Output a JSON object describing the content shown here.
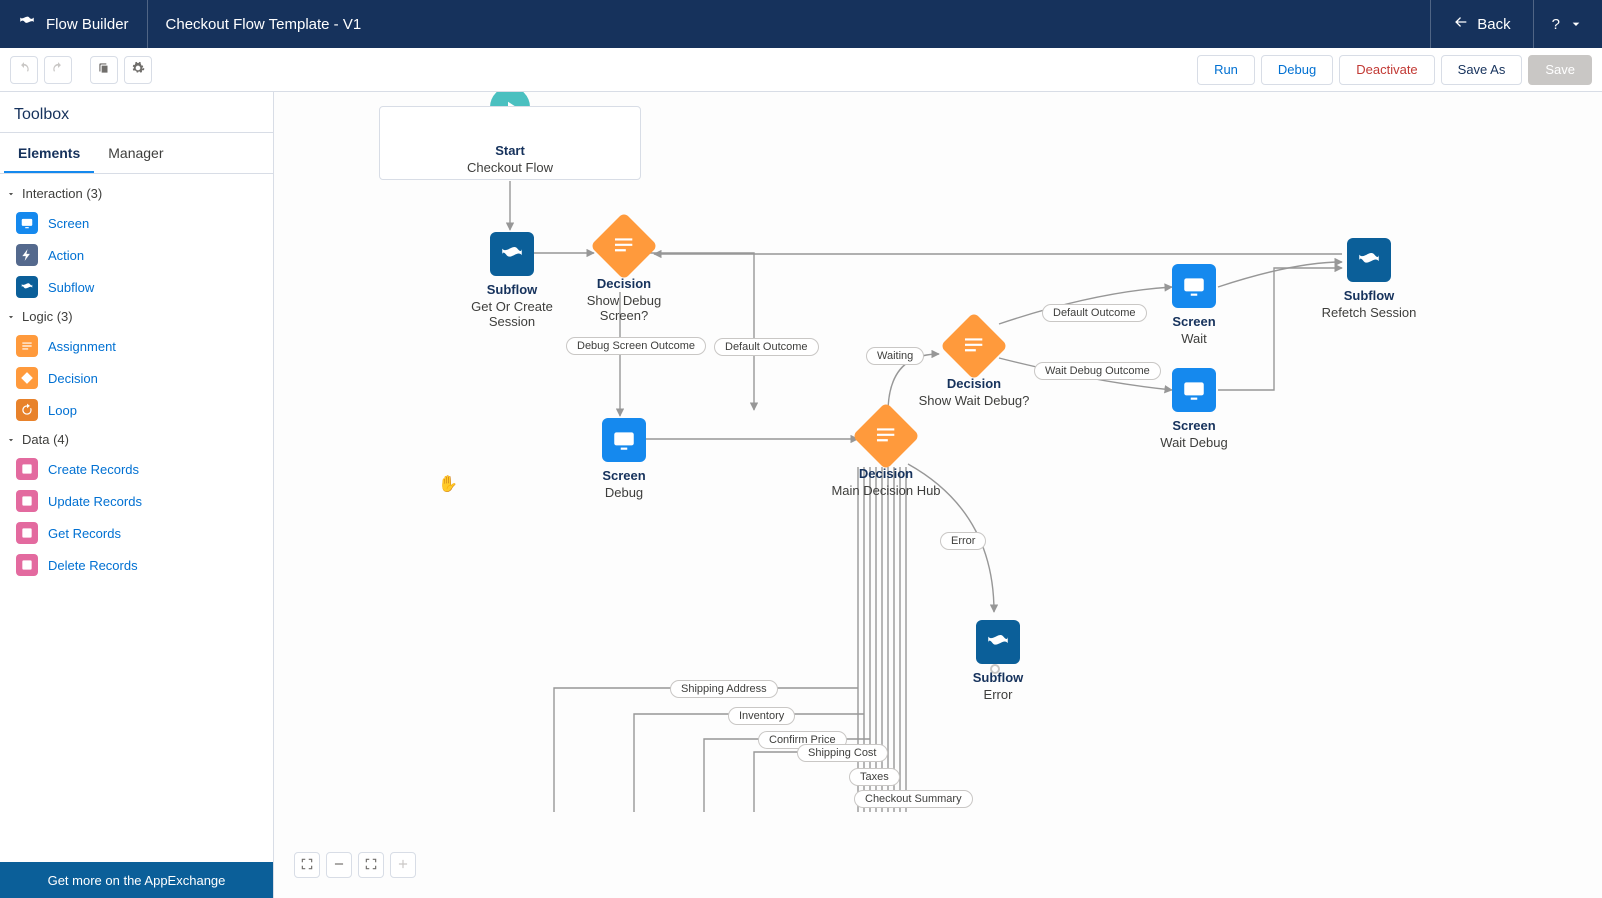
{
  "header": {
    "app_name": "Flow Builder",
    "flow_title": "Checkout Flow Template - V1",
    "back_label": "Back",
    "help_label": "?"
  },
  "actions": {
    "run": "Run",
    "debug": "Debug",
    "deactivate": "Deactivate",
    "save_as": "Save As",
    "save": "Save"
  },
  "sidebar": {
    "title": "Toolbox",
    "tabs": {
      "elements": "Elements",
      "manager": "Manager"
    },
    "groups": {
      "interaction": {
        "label": "Interaction (3)",
        "items": {
          "screen": "Screen",
          "action": "Action",
          "subflow": "Subflow"
        }
      },
      "logic": {
        "label": "Logic (3)",
        "items": {
          "assignment": "Assignment",
          "decision": "Decision",
          "loop": "Loop"
        }
      },
      "data": {
        "label": "Data (4)",
        "items": {
          "create": "Create Records",
          "update": "Update Records",
          "get": "Get Records",
          "delete": "Delete Records"
        }
      }
    },
    "appexchange": "Get more on the AppExchange"
  },
  "canvas": {
    "start": {
      "title": "Start",
      "sub": "Checkout Flow"
    },
    "subflow_session": {
      "title": "Subflow",
      "sub": "Get Or Create Session"
    },
    "decision_debug": {
      "title": "Decision",
      "sub": "Show Debug Screen?"
    },
    "screen_debug": {
      "title": "Screen",
      "sub": "Debug"
    },
    "decision_hub": {
      "title": "Decision",
      "sub": "Main Decision Hub"
    },
    "decision_wait": {
      "title": "Decision",
      "sub": "Show Wait Debug?"
    },
    "screen_wait": {
      "title": "Screen",
      "sub": "Wait"
    },
    "screen_wait_debug": {
      "title": "Screen",
      "sub": "Wait Debug"
    },
    "subflow_refetch": {
      "title": "Subflow",
      "sub": "Refetch Session"
    },
    "subflow_error": {
      "title": "Subflow",
      "sub": "Error"
    },
    "chips": {
      "debug_screen_outcome": "Debug Screen Outcome",
      "default_outcome_1": "Default Outcome",
      "waiting": "Waiting",
      "default_outcome_2": "Default Outcome",
      "wait_debug_outcome": "Wait Debug Outcome",
      "error": "Error",
      "shipping_address": "Shipping Address",
      "inventory": "Inventory",
      "confirm_price": "Confirm Price",
      "shipping_cost": "Shipping Cost",
      "taxes": "Taxes",
      "checkout_summary": "Checkout Summary"
    },
    "icons": {
      "undo": "undo",
      "redo": "redo",
      "copy": "copy",
      "gear": "gear",
      "fit": "fit",
      "minus": "minus",
      "collapse": "collapse",
      "plus": "plus"
    }
  }
}
